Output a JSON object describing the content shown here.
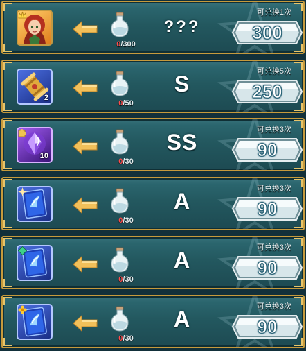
{
  "rows": [
    {
      "item_icon": "hero-portrait-icon",
      "item_frame": "orange",
      "item_qty": "",
      "badge": "crown-badge-icon",
      "cost_current": "0",
      "cost_total": "/300",
      "grade": "???",
      "limit": "可兑换1次",
      "price": "300"
    },
    {
      "item_icon": "scroll-icon",
      "item_frame": "blue",
      "item_qty": "2",
      "badge": "",
      "cost_current": "0",
      "cost_total": "/50",
      "grade": "S",
      "limit": "可兑换5次",
      "price": "250"
    },
    {
      "item_icon": "purple-crystal-icon",
      "item_frame": "purple",
      "item_qty": "10",
      "badge": "puzzle-badge-icon",
      "cost_current": "0",
      "cost_total": "/30",
      "grade": "SS",
      "limit": "可兑换3次",
      "price": "90"
    },
    {
      "item_icon": "blue-card-icon",
      "item_frame": "blue",
      "item_qty": "",
      "badge": "sparkle-badge-icon",
      "cost_current": "0",
      "cost_total": "/30",
      "grade": "A",
      "limit": "可兑换3次",
      "price": "90"
    },
    {
      "item_icon": "blue-card-icon",
      "item_frame": "blue",
      "item_qty": "",
      "badge": "green-gem-badge-icon",
      "cost_current": "0",
      "cost_total": "/30",
      "grade": "A",
      "limit": "可兑换3次",
      "price": "90"
    },
    {
      "item_icon": "blue-card-icon",
      "item_frame": "blue",
      "item_qty": "",
      "badge": "gold-flower-badge-icon",
      "cost_current": "0",
      "cost_total": "/30",
      "grade": "A",
      "limit": "可兑换3次",
      "price": "90"
    }
  ],
  "colors": {
    "row_bg": "#23585f",
    "frame_gold": "#c69a3c",
    "cost_current": "#ff4b4b",
    "arrow": "#f2c05a"
  }
}
